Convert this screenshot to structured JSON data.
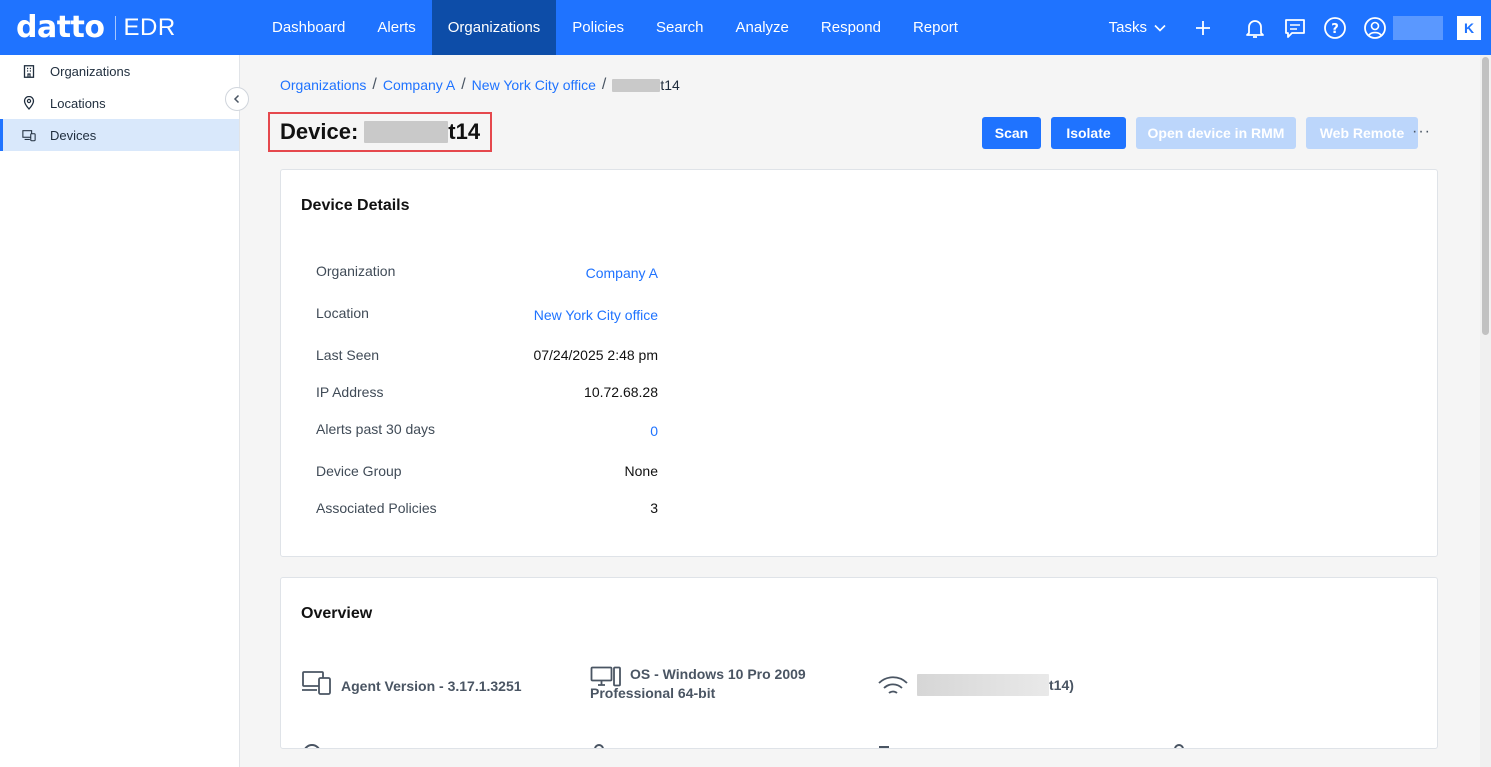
{
  "brand": {
    "name": "datto",
    "product": "EDR"
  },
  "nav": [
    {
      "label": "Dashboard"
    },
    {
      "label": "Alerts"
    },
    {
      "label": "Organizations"
    },
    {
      "label": "Policies"
    },
    {
      "label": "Search"
    },
    {
      "label": "Analyze"
    },
    {
      "label": "Respond"
    },
    {
      "label": "Report"
    }
  ],
  "topbar": {
    "tasks_label": "Tasks",
    "k_logo": "K"
  },
  "sidebar": {
    "items": [
      {
        "label": "Organizations",
        "icon": "building-icon"
      },
      {
        "label": "Locations",
        "icon": "map-pin-icon"
      },
      {
        "label": "Devices",
        "icon": "devices-icon"
      }
    ]
  },
  "breadcrumb": {
    "items": [
      "Organizations",
      "Company A",
      "New York City office"
    ],
    "current_suffix": "t14"
  },
  "page": {
    "title_prefix": "Device:",
    "title_suffix": "t14"
  },
  "actions": {
    "scan": "Scan",
    "isolate": "Isolate",
    "open_rmm": "Open device in RMM",
    "web_remote": "Web Remote",
    "more": "···"
  },
  "device_details": {
    "title": "Device Details",
    "rows": [
      {
        "label": "Organization",
        "value": "Company A"
      },
      {
        "label": "Location",
        "value": "New York City office"
      },
      {
        "label": "Last Seen",
        "value": "07/24/2025 2:48 pm"
      },
      {
        "label": "IP Address",
        "value": "10.72.68.28"
      },
      {
        "label": "Alerts past 30 days",
        "value": "0"
      },
      {
        "label": "Device Group",
        "value": "None"
      },
      {
        "label": "Associated Policies",
        "value": "3"
      }
    ]
  },
  "overview": {
    "title": "Overview",
    "agent_version": "Agent Version - 3.17.1.3251",
    "os_line1": "OS - Windows 10 Pro 2009",
    "os_line2": "Professional 64-bit",
    "network_suffix": "t14)"
  },
  "colors": {
    "accent": "#1f73ff",
    "nav_active": "#0d4da8",
    "highlight_border": "#e5484d"
  }
}
